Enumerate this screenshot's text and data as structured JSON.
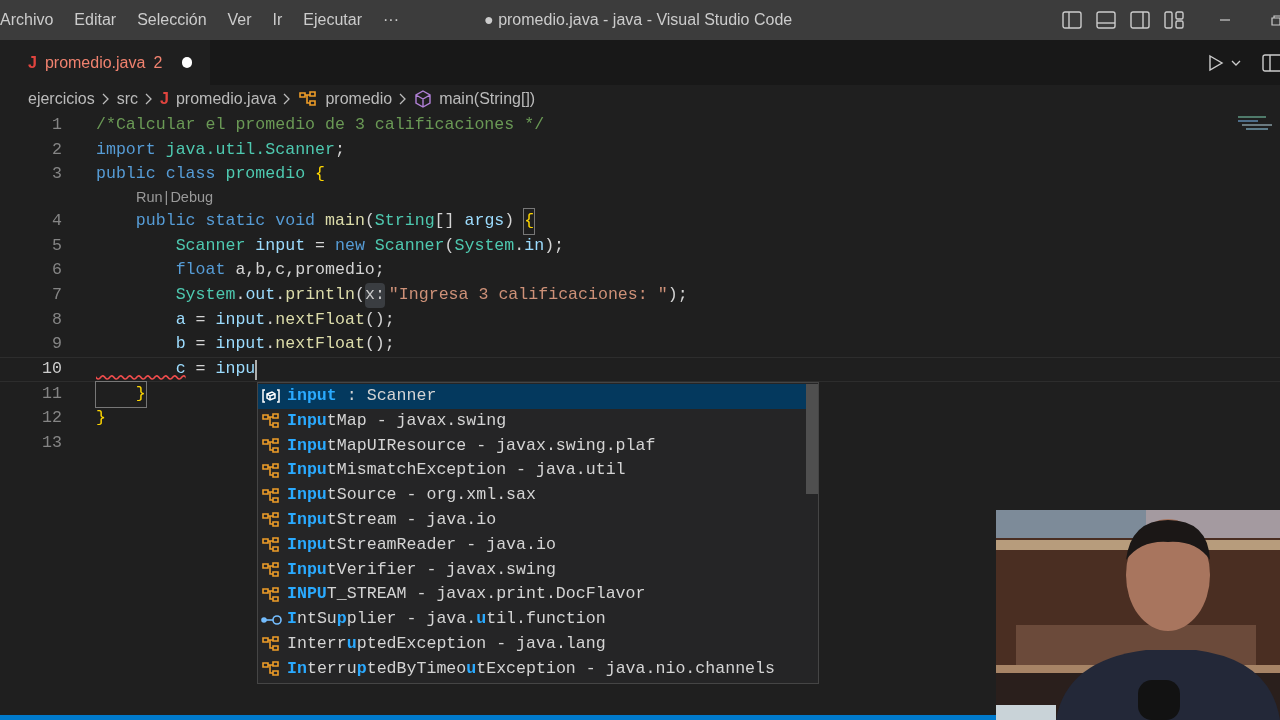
{
  "menu": [
    "Archivo",
    "Editar",
    "Selección",
    "Ver",
    "Ir",
    "Ejecutar",
    "···"
  ],
  "window": {
    "title": "● promedio.java - java - Visual Studio Code"
  },
  "tab": {
    "icon": "J",
    "label": "promedio.java",
    "problems": "2",
    "dirty": true
  },
  "breadcrumbs": [
    {
      "kind": "folder",
      "label": "ejercicios"
    },
    {
      "kind": "folder",
      "label": "src"
    },
    {
      "kind": "java",
      "icon": "J",
      "label": "promedio.java"
    },
    {
      "kind": "class",
      "label": "promedio"
    },
    {
      "kind": "method",
      "label": "main(String[])"
    }
  ],
  "editor": {
    "lines": [
      {
        "kind": "code",
        "number": "1",
        "current": false,
        "tokens": [
          {
            "text": "/*Calcular el promedio de 3 calificaciones */",
            "kind": "comment"
          }
        ]
      },
      {
        "kind": "code",
        "number": "2",
        "current": false,
        "tokens": [
          {
            "text": "import",
            "kind": "keyword"
          },
          {
            "text": " java.util.Scanner",
            "kind": "type"
          },
          {
            "text": ";",
            "kind": "plain"
          }
        ]
      },
      {
        "kind": "code",
        "number": "3",
        "current": false,
        "tokens": [
          {
            "text": "public class",
            "kind": "keyword"
          },
          {
            "text": " promedio",
            "kind": "type"
          },
          {
            "text": " {",
            "kind": "bracket"
          }
        ]
      },
      {
        "kind": "codelens",
        "links": [
          "Run",
          "Debug"
        ],
        "separator": "|"
      },
      {
        "kind": "code",
        "number": "4",
        "current": false,
        "tokens": [
          {
            "text": "    public static void",
            "kind": "keyword"
          },
          {
            "text": " main",
            "kind": "function"
          },
          {
            "text": "(",
            "kind": "plain"
          },
          {
            "text": "String",
            "kind": "type"
          },
          {
            "text": "[] ",
            "kind": "plain"
          },
          {
            "text": "args",
            "kind": "variable"
          },
          {
            "text": ") ",
            "kind": "plain"
          },
          {
            "text": "{",
            "kind": "bracket",
            "boxed": true
          }
        ]
      },
      {
        "kind": "code",
        "number": "5",
        "current": false,
        "tokens": [
          {
            "text": "        Scanner",
            "kind": "type"
          },
          {
            "text": " input",
            "kind": "variable"
          },
          {
            "text": " = ",
            "kind": "plain"
          },
          {
            "text": "new",
            "kind": "keyword"
          },
          {
            "text": " Scanner",
            "kind": "type"
          },
          {
            "text": "(",
            "kind": "plain"
          },
          {
            "text": "System",
            "kind": "type"
          },
          {
            "text": ".",
            "kind": "plain"
          },
          {
            "text": "in",
            "kind": "variable"
          },
          {
            "text": ");",
            "kind": "plain"
          }
        ]
      },
      {
        "kind": "code",
        "number": "6",
        "current": false,
        "tokens": [
          {
            "text": "        float",
            "kind": "keyword"
          },
          {
            "text": " a,b,c,promedio;",
            "kind": "plain"
          }
        ]
      },
      {
        "kind": "code",
        "number": "7",
        "current": false,
        "tokens": [
          {
            "text": "        System",
            "kind": "type"
          },
          {
            "text": ".",
            "kind": "plain"
          },
          {
            "text": "out",
            "kind": "variable"
          },
          {
            "text": ".",
            "kind": "plain"
          },
          {
            "text": "println",
            "kind": "function"
          },
          {
            "text": "(",
            "kind": "plain"
          },
          {
            "text": "x:",
            "kind": "hint"
          },
          {
            "text": "\"Ingresa 3 calificaciones: \"",
            "kind": "string"
          },
          {
            "text": ");",
            "kind": "plain"
          }
        ]
      },
      {
        "kind": "code",
        "number": "8",
        "current": false,
        "tokens": [
          {
            "text": "        a",
            "kind": "variable"
          },
          {
            "text": " = ",
            "kind": "plain"
          },
          {
            "text": "input",
            "kind": "variable"
          },
          {
            "text": ".",
            "kind": "plain"
          },
          {
            "text": "nextFloat",
            "kind": "function"
          },
          {
            "text": "();",
            "kind": "plain"
          }
        ]
      },
      {
        "kind": "code",
        "number": "9",
        "current": false,
        "tokens": [
          {
            "text": "        b",
            "kind": "variable"
          },
          {
            "text": " = ",
            "kind": "plain"
          },
          {
            "text": "input",
            "kind": "variable"
          },
          {
            "text": ".",
            "kind": "plain"
          },
          {
            "text": "nextFloat",
            "kind": "function"
          },
          {
            "text": "();",
            "kind": "plain"
          }
        ]
      },
      {
        "kind": "code",
        "number": "10",
        "current": true,
        "tokens": [
          {
            "text": "        c",
            "kind": "variable",
            "squiggle": true
          },
          {
            "text": " = ",
            "kind": "plain"
          },
          {
            "text": "inpu",
            "kind": "variable"
          }
        ]
      },
      {
        "kind": "code",
        "number": "11",
        "current": false,
        "tokens": [
          {
            "text": "    }",
            "kind": "bracket",
            "boxed": true
          }
        ]
      },
      {
        "kind": "code",
        "number": "12",
        "current": false,
        "tokens": [
          {
            "text": "}",
            "kind": "bracket"
          }
        ]
      },
      {
        "kind": "code",
        "number": "13",
        "current": false
      }
    ]
  },
  "suggestions": [
    {
      "kind": "variable",
      "selected": true,
      "parts": [
        {
          "text": "input",
          "match": true
        },
        {
          "text": " : Scanner",
          "match": false
        }
      ]
    },
    {
      "kind": "class",
      "selected": false,
      "parts": [
        {
          "text": "Inpu",
          "match": true
        },
        {
          "text": "tMap - javax.swing",
          "match": false
        }
      ]
    },
    {
      "kind": "class",
      "selected": false,
      "parts": [
        {
          "text": "Inpu",
          "match": true
        },
        {
          "text": "tMapUIResource - javax.swing.plaf",
          "match": false
        }
      ]
    },
    {
      "kind": "class",
      "selected": false,
      "parts": [
        {
          "text": "Inpu",
          "match": true
        },
        {
          "text": "tMismatchException - java.util",
          "match": false
        }
      ]
    },
    {
      "kind": "class",
      "selected": false,
      "parts": [
        {
          "text": "Inpu",
          "match": true
        },
        {
          "text": "tSource - org.xml.sax",
          "match": false
        }
      ]
    },
    {
      "kind": "class",
      "selected": false,
      "parts": [
        {
          "text": "Inpu",
          "match": true
        },
        {
          "text": "tStream - java.io",
          "match": false
        }
      ]
    },
    {
      "kind": "class",
      "selected": false,
      "parts": [
        {
          "text": "Inpu",
          "match": true
        },
        {
          "text": "tStreamReader - java.io",
          "match": false
        }
      ]
    },
    {
      "kind": "class",
      "selected": false,
      "parts": [
        {
          "text": "Inpu",
          "match": true
        },
        {
          "text": "tVerifier - javax.swing",
          "match": false
        }
      ]
    },
    {
      "kind": "class",
      "selected": false,
      "parts": [
        {
          "text": "INPU",
          "match": true
        },
        {
          "text": "T_STREAM - javax.print.DocFlavor",
          "match": false
        }
      ]
    },
    {
      "kind": "interface",
      "selected": false,
      "parts": [
        {
          "text": "I",
          "match": true
        },
        {
          "text": "ntSu",
          "match": false
        },
        {
          "text": "p",
          "match": true
        },
        {
          "text": "plier - java.",
          "match": false
        },
        {
          "text": "u",
          "match": true
        },
        {
          "text": "til.function",
          "match": false
        }
      ]
    },
    {
      "kind": "class",
      "selected": false,
      "parts": [
        {
          "text": "Interr",
          "match": false
        },
        {
          "text": "u",
          "match": true
        },
        {
          "text": "ptedException - java.lang",
          "match": false
        }
      ]
    },
    {
      "kind": "class",
      "selected": false,
      "parts": [
        {
          "text": "In",
          "match": true
        },
        {
          "text": "terru",
          "match": false
        },
        {
          "text": "p",
          "match": true
        },
        {
          "text": "tedByTimeo",
          "match": false
        },
        {
          "text": "u",
          "match": true
        },
        {
          "text": "tException - java.nio.channels",
          "match": false
        }
      ]
    }
  ],
  "webcam": {
    "kind": "picture"
  }
}
